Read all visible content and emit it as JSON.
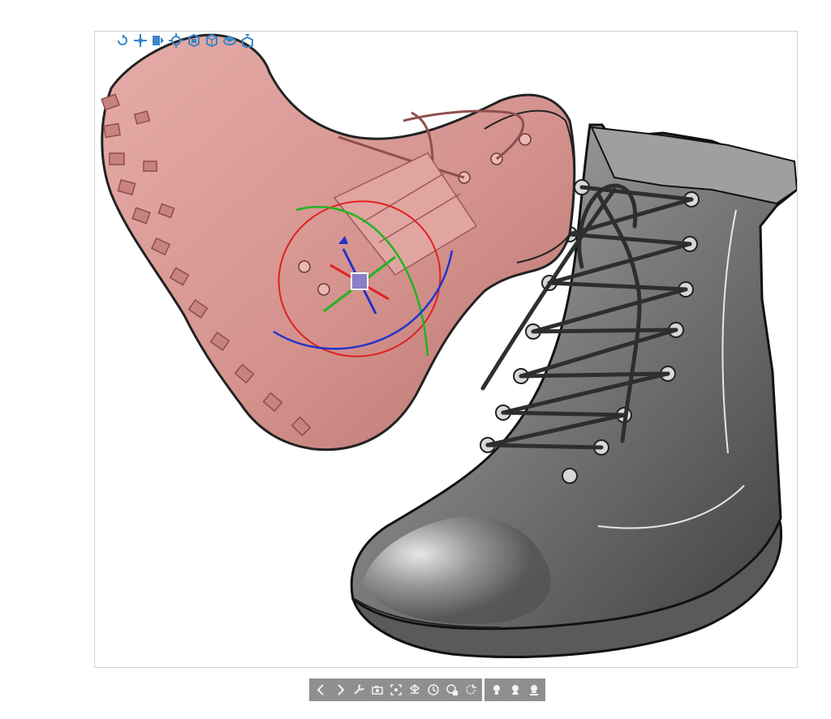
{
  "viewport": {
    "background": "#ffffff",
    "model_colors": {
      "selected_boot": "#d99a96",
      "selected_boot_shadow": "#9c5a56",
      "boot": "#8c8c8c",
      "boot_dark": "#4a4a4a",
      "gizmo_x": "#e02020",
      "gizmo_y": "#22b422",
      "gizmo_z": "#2233cc",
      "gizmo_center": "#8a7fc8"
    }
  },
  "view_toolbar": {
    "icons": [
      "rotate-view-icon",
      "pan-view-icon",
      "zoom-view-icon",
      "fit-view-icon",
      "front-view-icon",
      "iso-view-icon",
      "orbit-view-icon",
      "top-view-icon"
    ],
    "icon_color": "#3a86c8"
  },
  "bottom_toolbar": {
    "background": "#8f8f8f",
    "icon_color": "#f2f2f2",
    "groups": [
      [
        "previous-icon",
        "next-icon",
        "wrench-icon",
        "camera-icon",
        "select-box-icon",
        "measure-icon",
        "clock-icon",
        "snapshot-icon",
        "rotate-icon"
      ],
      [
        "light-1-icon",
        "light-2-icon",
        "light-3-icon"
      ]
    ]
  }
}
